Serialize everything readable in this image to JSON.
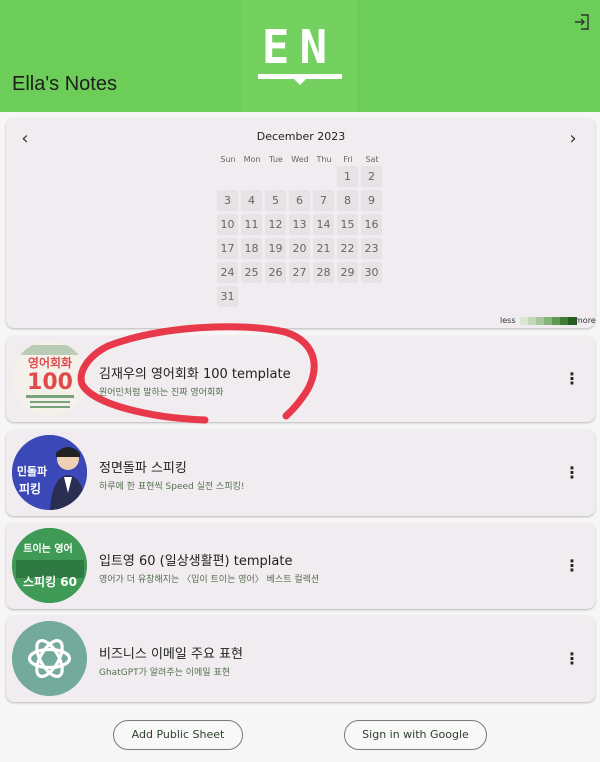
{
  "header": {
    "app_title": "Ella's Notes",
    "logo_text": "EN",
    "login_icon": "login-icon",
    "background_color": "#6dcd59"
  },
  "calendar": {
    "month_label": "December 2023",
    "prev_icon": "chevron-left-icon",
    "next_icon": "chevron-right-icon",
    "weekdays": [
      "Sun",
      "Mon",
      "Tue",
      "Wed",
      "Thu",
      "Fri",
      "Sat"
    ],
    "days": [
      "1",
      "2",
      "3",
      "4",
      "5",
      "6",
      "7",
      "8",
      "9",
      "10",
      "11",
      "12",
      "13",
      "14",
      "15",
      "16",
      "17",
      "18",
      "19",
      "20",
      "21",
      "22",
      "23",
      "24",
      "25",
      "26",
      "27",
      "28",
      "29",
      "30",
      "31"
    ],
    "legend_less": "less",
    "legend_more": "more",
    "legend_colors": [
      "#dde6d6",
      "#c6d8bc",
      "#a9c79c",
      "#87b479",
      "#5f9a52",
      "#3e7c34",
      "#255f1f"
    ]
  },
  "sheets": [
    {
      "title": "김재우의 영어회화 100 template",
      "subtitle": "원어민처럼 말하는 진짜 영어회화",
      "thumb_text_top": "영어회화",
      "thumb_text_big": "100",
      "menu_icon": "more-vert-icon"
    },
    {
      "title": "정면돌파 스피킹",
      "subtitle": "하루에 한 표현씩 Speed 실전 스피킹!",
      "thumb_text_top": "민돌파",
      "thumb_text_big": "피킹",
      "menu_icon": "more-vert-icon"
    },
    {
      "title": "입트영 60 (일상생활편) template",
      "subtitle": "영어가 더 유창해지는 〈입이 트이는 영어〉 베스트 컬렉션",
      "thumb_text_top": "트이는 영어",
      "thumb_text_big": "스피킹 60",
      "menu_icon": "more-vert-icon"
    },
    {
      "title": "비즈니스 이메일 주요 표현",
      "subtitle": "GhatGPT가 알려주는 이메일 표현",
      "thumb_icon": "openai-logo-icon",
      "menu_icon": "more-vert-icon"
    }
  ],
  "actions": {
    "add_public_sheet": "Add Public Sheet",
    "sign_in_google": "Sign in with Google"
  },
  "annotation": {
    "stroke_color": "#e8394a"
  }
}
